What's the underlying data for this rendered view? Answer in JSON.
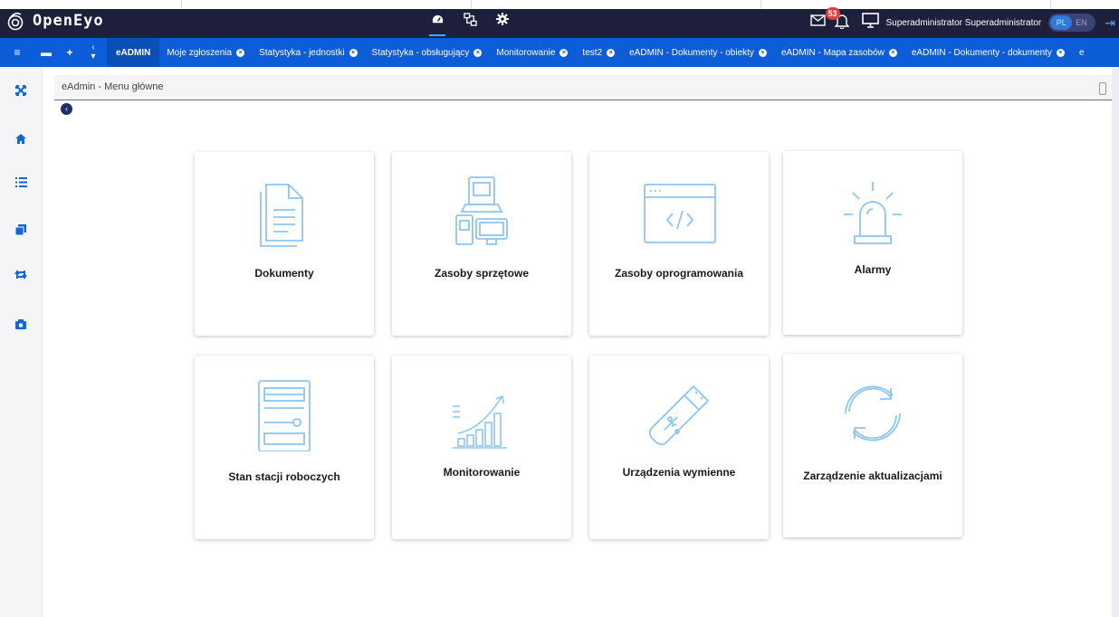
{
  "app": {
    "title": "OpenEyo"
  },
  "header": {
    "user": "Superadministrator Superadministrator",
    "notifications_count": "53",
    "lang_pl": "PL",
    "lang_en": "EN"
  },
  "tabs": [
    {
      "label": "eADMIN",
      "active": true
    },
    {
      "label": "Moje zgłoszenia"
    },
    {
      "label": "Statystyka - jednostki"
    },
    {
      "label": "Statystyka - obsługujący"
    },
    {
      "label": "Monitorowanie"
    },
    {
      "label": "test2"
    },
    {
      "label": "eADMIN - Dokumenty - obiekty"
    },
    {
      "label": "eADMIN - Mapa zasobów"
    },
    {
      "label": "eADMIN - Dokumenty - dokumenty"
    },
    {
      "label": "e"
    }
  ],
  "breadcrumb": "eAdmin - Menu główne",
  "tiles": [
    {
      "label": "Dokumenty",
      "icon": "document-icon"
    },
    {
      "label": "Zasoby sprzętowe",
      "icon": "hardware-icon"
    },
    {
      "label": "Zasoby oprogramowania",
      "icon": "code-window-icon"
    },
    {
      "label": "Alarmy",
      "icon": "alarm-light-icon"
    },
    {
      "label": "Stan stacji roboczych",
      "icon": "workstation-icon"
    },
    {
      "label": "Monitorowanie",
      "icon": "growth-chart-icon"
    },
    {
      "label": "Urządzenia wymienne",
      "icon": "usb-drive-icon"
    },
    {
      "label": "Zarządzenie aktualizacjami",
      "icon": "refresh-icon"
    }
  ],
  "colors": {
    "header": "#1d1f3b",
    "tabbar": "#0d5cd8",
    "icon": "#8ec5ef",
    "accent": "#1565d8"
  }
}
